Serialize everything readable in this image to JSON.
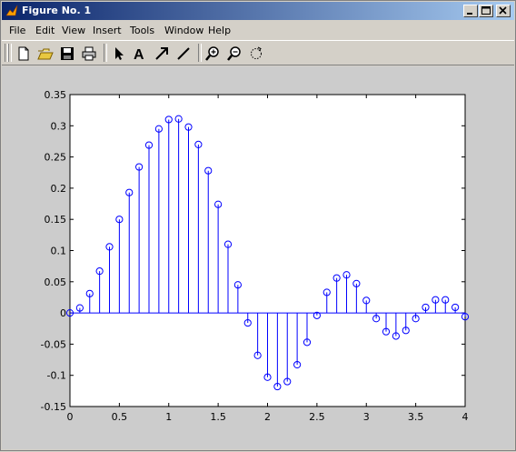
{
  "window": {
    "title": "Figure No. 1"
  },
  "menubar": {
    "items": [
      "File",
      "Edit",
      "View",
      "Insert",
      "Tools",
      "Window",
      "Help"
    ]
  },
  "toolbar": {
    "buttons": [
      "new-file-icon",
      "open-folder-icon",
      "save-icon",
      "print-icon",
      "pointer-arrow-icon",
      "insert-text-icon",
      "insert-arrow-icon",
      "insert-line-icon",
      "zoom-in-icon",
      "zoom-out-icon",
      "rotate-icon"
    ],
    "text_tool_label": "A"
  },
  "colors": {
    "stem": "#0000ff",
    "titlebar_start": "#0a246a",
    "titlebar_end": "#a6caf0",
    "figure_bg": "#cccccc"
  },
  "chart_data": {
    "type": "stem",
    "xlim": [
      0,
      4
    ],
    "ylim": [
      -0.15,
      0.35
    ],
    "xticks": [
      "0",
      "0.5",
      "1",
      "1.5",
      "2",
      "2.5",
      "3",
      "3.5",
      "4"
    ],
    "xtick_values": [
      0,
      0.5,
      1,
      1.5,
      2,
      2.5,
      3,
      3.5,
      4
    ],
    "yticks": [
      "-0.15",
      "-0.1",
      "-0.05",
      "0",
      "0.05",
      "0.1",
      "0.15",
      "0.2",
      "0.25",
      "0.3",
      "0.35"
    ],
    "ytick_values": [
      -0.15,
      -0.1,
      -0.05,
      0,
      0.05,
      0.1,
      0.15,
      0.2,
      0.25,
      0.3,
      0.35
    ],
    "marker": "circle",
    "grid": false,
    "x": [
      0,
      0.1,
      0.2,
      0.3,
      0.4,
      0.5,
      0.6,
      0.7,
      0.8,
      0.9,
      1.0,
      1.1,
      1.2,
      1.3,
      1.4,
      1.5,
      1.6,
      1.7,
      1.8,
      1.9,
      2.0,
      2.1,
      2.2,
      2.3,
      2.4,
      2.5,
      2.6,
      2.7,
      2.8,
      2.9,
      3.0,
      3.1,
      3.2,
      3.3,
      3.4,
      3.5,
      3.6,
      3.7,
      3.8,
      3.9,
      4.0
    ],
    "y": [
      0,
      0.008,
      0.031,
      0.067,
      0.106,
      0.15,
      0.193,
      0.234,
      0.269,
      0.295,
      0.31,
      0.311,
      0.298,
      0.27,
      0.228,
      0.174,
      0.11,
      0.045,
      -0.016,
      -0.068,
      -0.103,
      -0.118,
      -0.11,
      -0.083,
      -0.047,
      -0.004,
      0.033,
      0.056,
      0.061,
      0.047,
      0.02,
      -0.009,
      -0.03,
      -0.037,
      -0.028,
      -0.009,
      0.009,
      0.021,
      0.021,
      0.009,
      -0.006
    ]
  }
}
